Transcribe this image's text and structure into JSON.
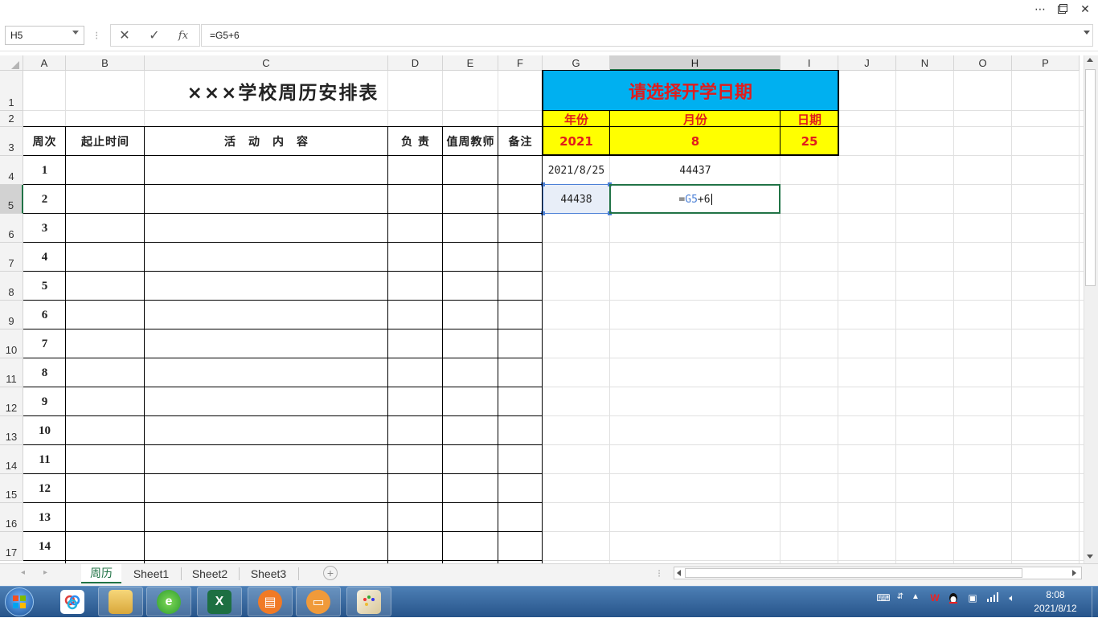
{
  "window": {
    "more_icon": "ellipsis-icon",
    "restore_icon": "restore-window-icon",
    "close_icon": "close-icon"
  },
  "formula_bar": {
    "name_box": "H5",
    "cancel_symbol": "✕",
    "enter_symbol": "✓",
    "fx_label": "fx",
    "formula": "=G5+6"
  },
  "columns": [
    "A",
    "B",
    "C",
    "D",
    "E",
    "F",
    "G",
    "H",
    "I",
    "J",
    "N",
    "O",
    "P"
  ],
  "rows": [
    "1",
    "2",
    "3",
    "4",
    "5",
    "6",
    "7",
    "8",
    "9",
    "10",
    "11",
    "12",
    "13",
    "14",
    "15",
    "16",
    "17"
  ],
  "sheet": {
    "title": "×××学校周历安排表",
    "headers": {
      "week": "周次",
      "start_end": "起止时间",
      "activity": "活　动　内　容",
      "responsible": "负 责",
      "duty_teacher": "值周教师",
      "remarks": "备注"
    },
    "weeks": [
      "1",
      "2",
      "3",
      "4",
      "5",
      "6",
      "7",
      "8",
      "9",
      "10",
      "11",
      "12",
      "13",
      "14"
    ],
    "date_panel": {
      "prompt": "请选择开学日期",
      "year_label": "年份",
      "month_label": "月份",
      "day_label": "日期",
      "year": "2021",
      "month": "8",
      "day": "25"
    },
    "g4": "2021/8/25",
    "h4": "44437",
    "g5": "44438",
    "h5_editing": "=G5+6"
  },
  "tabs": [
    "周历",
    "Sheet1",
    "Sheet2",
    "Sheet3"
  ],
  "active_tab": "周历",
  "taskbar": {
    "apps": [
      "baidu-netdisk",
      "file-explorer",
      "browser",
      "excel",
      "wps-office",
      "briefcase-app",
      "paint-app"
    ],
    "time": "8:08",
    "date": "2021/8/12"
  },
  "colors": {
    "accent": "#217346",
    "cyan": "#00b0f0",
    "yellow": "#ffff00",
    "red_text": "#e11c1c"
  }
}
